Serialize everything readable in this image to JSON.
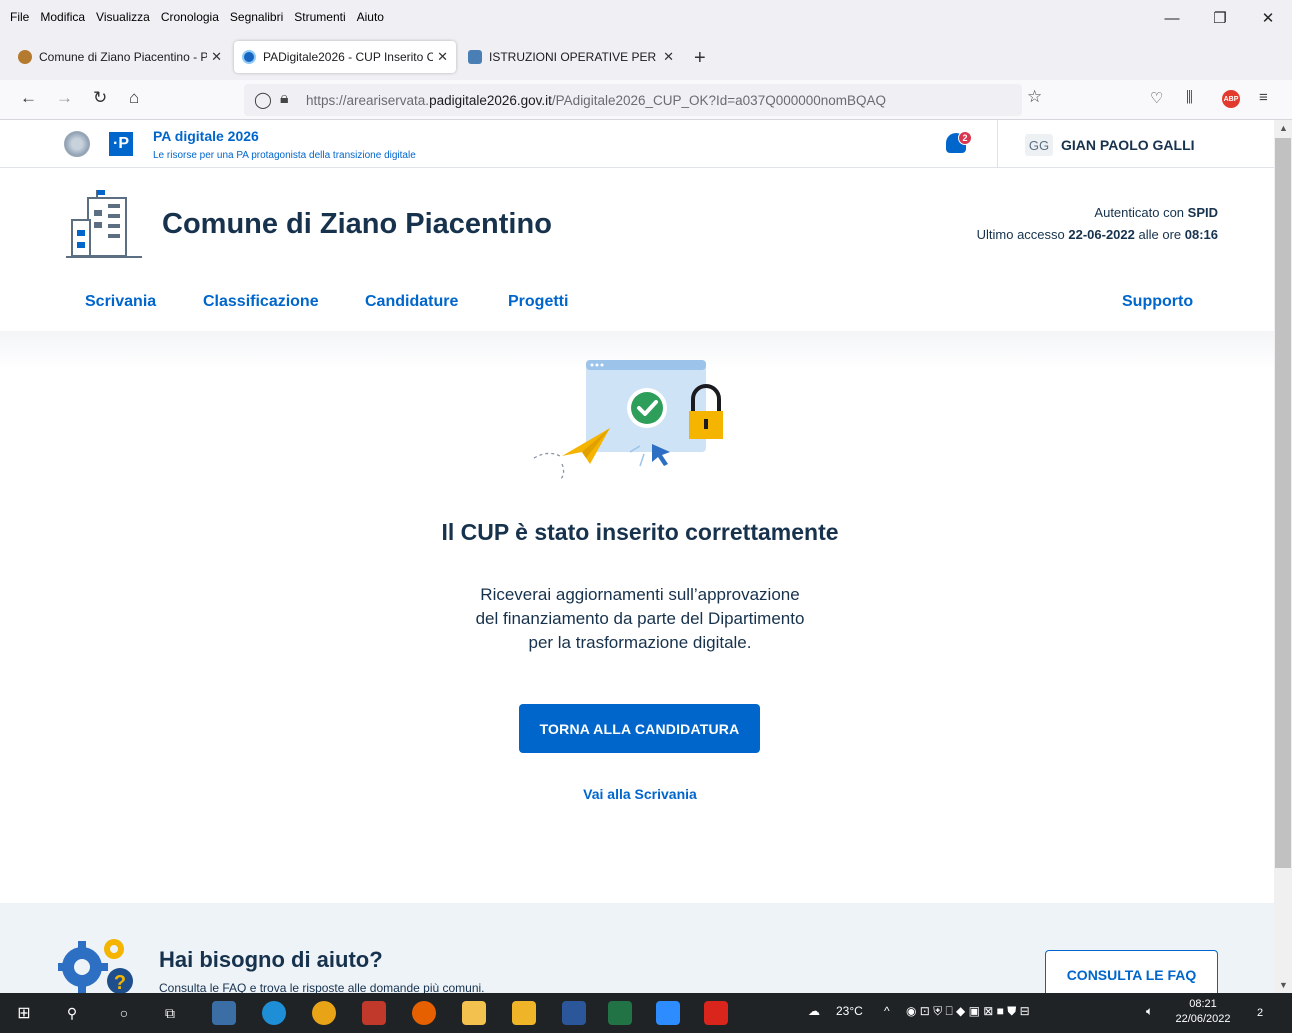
{
  "menubar": {
    "items": [
      "File",
      "Modifica",
      "Visualizza",
      "Cronologia",
      "Segnalibri",
      "Strumenti",
      "Aiuto"
    ]
  },
  "tabs": [
    {
      "title": "Comune di Ziano Piacentino - P",
      "close": "✕"
    },
    {
      "title": "PADigitale2026 - CUP Inserito C",
      "close": "✕"
    },
    {
      "title": "ISTRUZIONI OPERATIVE PER LA ",
      "close": "✕"
    }
  ],
  "newtab": "+",
  "address": {
    "prefix": "https://areariservata.",
    "domain": "padigitale2026.gov.it",
    "path": "/PAdigitale2026_CUP_OK?Id=a037Q000000nomBQAQ"
  },
  "site": {
    "brand_title": "PA digitale 2026",
    "brand_sub": "Le risorse per una PA protagonista della transizione digitale",
    "logo_letter": "·P",
    "notification_count": "2",
    "user_initials": "GG",
    "user_name": "GIAN PAOLO GALLI",
    "org_name": "Comune di Ziano Piacentino",
    "auth_prefix": "Autenticato con ",
    "auth_method": "SPID",
    "last_access_prefix": "Ultimo accesso ",
    "last_access_date": "22-06-2022",
    "last_access_mid": " alle ore ",
    "last_access_time": "08:16"
  },
  "nav": {
    "desk": "Scrivania",
    "classification": "Classificazione",
    "applications": "Candidature",
    "projects": "Progetti",
    "support": "Supporto"
  },
  "result": {
    "title": "Il CUP è stato inserito correttamente",
    "line1": "Riceverai aggiornamenti sull’approvazione",
    "line2": "del finanziamento da parte del Dipartimento",
    "line3": "per la trasformazione digitale.",
    "button": "TORNA ALLA CANDIDATURA",
    "link": "Vai alla Scrivania"
  },
  "help": {
    "title": "Hai bisogno di aiuto?",
    "text": "Consulta le FAQ e trova le risposte alle domande più comuni.",
    "button": "CONSULTA LE FAQ"
  },
  "taskbar": {
    "weather": "23°C",
    "time": "08:21",
    "date": "22/06/2022",
    "notifications": "2"
  },
  "colors": {
    "primary": "#0066cc",
    "text_dark": "#17324d",
    "alert": "#d9364f",
    "success": "#2e9e5b",
    "lock": "#f5b400"
  }
}
